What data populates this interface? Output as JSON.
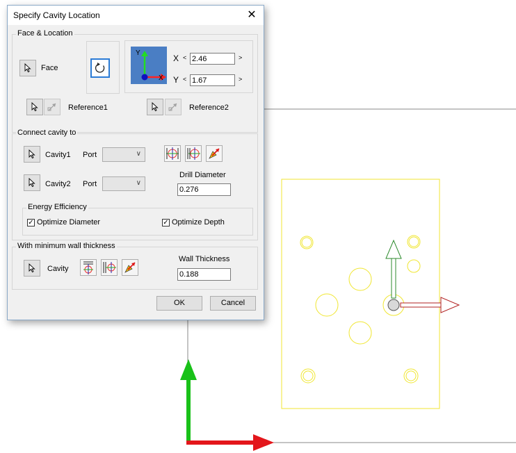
{
  "dialog": {
    "title": "Specify Cavity Location",
    "close_glyph": "✕",
    "face_location": {
      "group_label": "Face & Location",
      "face_label": "Face",
      "x_label": "X",
      "x_value": "2.46",
      "y_label": "Y",
      "y_value": "1.67",
      "axis_y": "Y",
      "axis_x": "X",
      "reference1_label": "Reference1",
      "reference2_label": "Reference2"
    },
    "connect": {
      "group_label": "Connect cavity to",
      "cavity1_label": "Cavity1",
      "cavity2_label": "Cavity2",
      "port_label": "Port",
      "port1_value": "",
      "port2_value": "",
      "drill_diameter_label": "Drill Diameter",
      "drill_diameter_value": "0.276"
    },
    "energy": {
      "group_label": "Energy Efficiency",
      "optimize_diameter_label": "Optimize Diameter",
      "optimize_diameter_checked": true,
      "optimize_depth_label": "Optimize Depth",
      "optimize_depth_checked": true
    },
    "wall": {
      "group_label": "With minimum wall thickness",
      "cavity_label": "Cavity",
      "wall_thickness_label": "Wall Thickness",
      "wall_thickness_value": "0.188"
    },
    "ok_label": "OK",
    "cancel_label": "Cancel"
  },
  "icons": {
    "pointer": "cursor-arrow-icon",
    "refresh": "rotate-icon",
    "dimension": "dimension-icon",
    "align": "align-center-icon",
    "pick": "pick-point-icon"
  },
  "colors": {
    "cad_outline": "#f0e630",
    "axis_red": "#e3161b",
    "axis_green": "#19c119",
    "manipulator_green": "#2e8b2e",
    "manipulator_red": "#b22222",
    "preview_bg": "#4a7ec4",
    "refresh_border": "#2b7bd6"
  }
}
